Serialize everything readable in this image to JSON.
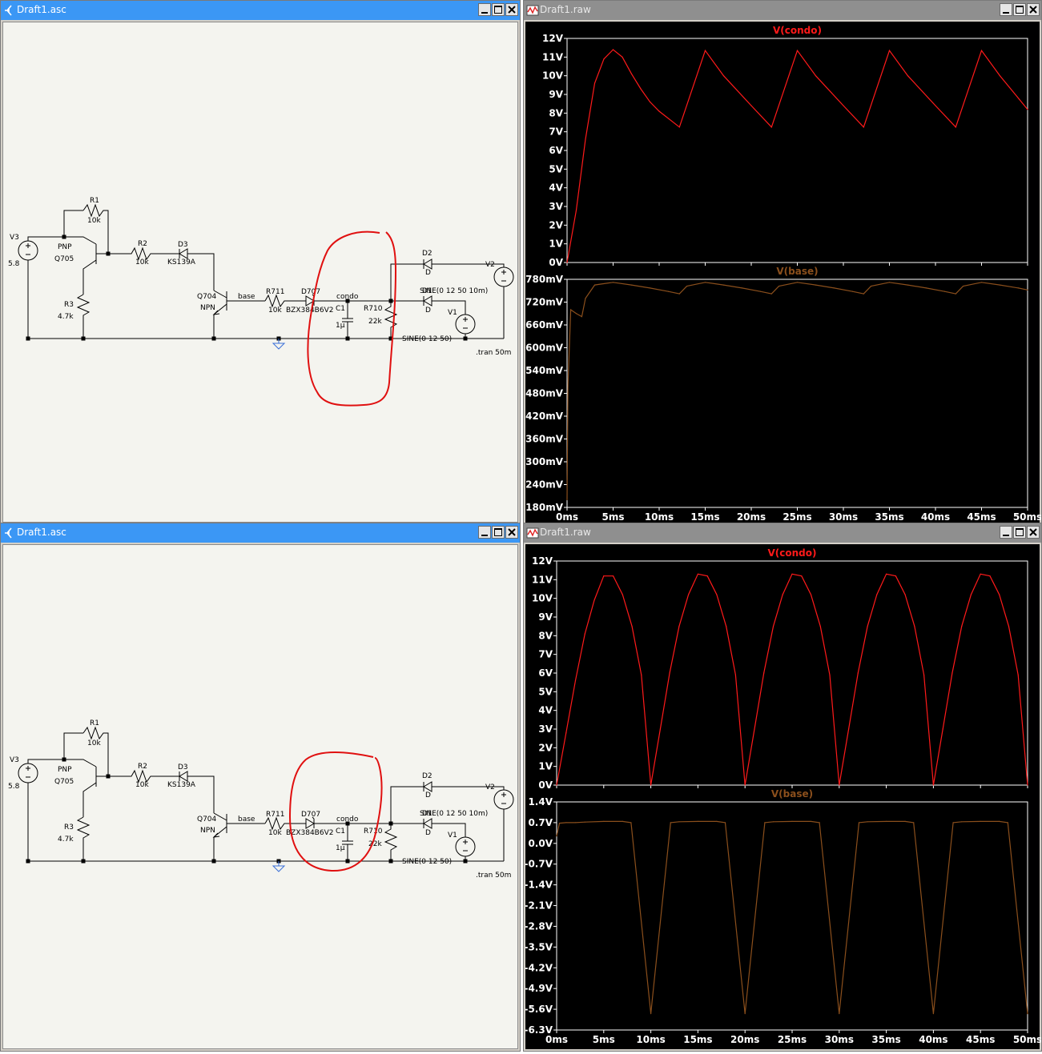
{
  "windows": {
    "schematic_top": {
      "title": "Draft1.asc"
    },
    "waveform_top": {
      "title": "Draft1.raw"
    },
    "schematic_bottom": {
      "title": "Draft1.asc"
    },
    "waveform_bottom": {
      "title": "Draft1.raw"
    }
  },
  "schematic": {
    "labels": {
      "v3": "V3",
      "v3_val": "5.8",
      "r1": "R1",
      "r1_val": "10k",
      "q705_type": "PNP",
      "q705": "Q705",
      "r2": "R2",
      "r2_val": "10k",
      "d3": "D3",
      "d3_val": "KS139A",
      "r3": "R3",
      "r3_val": "4.7k",
      "q704": "Q704",
      "q704_type": "NPN",
      "net_base": "base",
      "r711": "R711",
      "r711_val": "10k",
      "d707": "D707",
      "d707_val": "BZX384B6V2",
      "net_condo": "condo",
      "c1": "C1",
      "c1_val": "1µ",
      "r710": "R710",
      "r710_val": "22k",
      "d2": "D2",
      "d2_val": "D",
      "d1": "D1",
      "d1_val": "D",
      "v2": "V2",
      "v2_val": "SINE(0 12 50 10m)",
      "v1": "V1",
      "v1_val": "SINE(0 12 50)",
      "tran": ".tran 50m"
    }
  },
  "colors": {
    "condo": "#ff1a1a",
    "base": "#8b4f1c",
    "annotation": "#e01010",
    "accent": "#3b97f5"
  },
  "chart_data": [
    {
      "type": "line",
      "title": "V(condo)",
      "series": [
        {
          "name": "V(condo)",
          "x": [
            0,
            1,
            2,
            3,
            4,
            5,
            6,
            7,
            8,
            9,
            10,
            12.2,
            15,
            17,
            20,
            22.2,
            25,
            27,
            30,
            32.2,
            35,
            37,
            40,
            42.2,
            45,
            47,
            50
          ],
          "values": [
            0,
            2.8,
            6.6,
            9.6,
            10.9,
            11.4,
            11,
            10.1,
            9.3,
            8.6,
            8.1,
            7.25,
            11.35,
            10,
            8.4,
            7.25,
            11.35,
            10,
            8.4,
            7.25,
            11.35,
            10,
            8.4,
            7.25,
            11.35,
            10,
            8.2
          ]
        }
      ],
      "ylim": [
        0,
        12
      ],
      "yticks": [
        "0V",
        "1V",
        "2V",
        "3V",
        "4V",
        "5V",
        "6V",
        "7V",
        "8V",
        "9V",
        "10V",
        "11V",
        "12V"
      ],
      "xticks": [
        "0ms",
        "5ms",
        "10ms",
        "15ms",
        "20ms",
        "25ms",
        "30ms",
        "35ms",
        "40ms",
        "45ms",
        "50ms"
      ],
      "xlim": [
        0,
        50
      ]
    },
    {
      "type": "line",
      "title": "V(base)",
      "series": [
        {
          "name": "V(base)",
          "x": [
            0,
            0.1,
            0.4,
            1,
            1.6,
            2,
            3,
            5,
            7,
            9,
            11,
            12.2,
            13,
            15,
            17,
            19,
            21,
            22.2,
            23,
            25,
            27,
            29,
            31,
            32.2,
            33,
            35,
            37,
            39,
            41,
            42.2,
            43,
            45,
            47,
            49,
            50
          ],
          "values": [
            0.2,
            0.5,
            0.7,
            0.69,
            0.682,
            0.73,
            0.765,
            0.772,
            0.765,
            0.757,
            0.748,
            0.742,
            0.762,
            0.772,
            0.765,
            0.757,
            0.748,
            0.742,
            0.762,
            0.772,
            0.765,
            0.757,
            0.748,
            0.742,
            0.762,
            0.772,
            0.765,
            0.757,
            0.748,
            0.742,
            0.762,
            0.772,
            0.765,
            0.757,
            0.752
          ]
        }
      ],
      "ylim": [
        0.18,
        0.78
      ],
      "yticks": [
        "180mV",
        "240mV",
        "300mV",
        "360mV",
        "420mV",
        "480mV",
        "540mV",
        "600mV",
        "660mV",
        "720mV",
        "780mV"
      ],
      "xticks": [
        "0ms",
        "5ms",
        "10ms",
        "15ms",
        "20ms",
        "25ms",
        "30ms",
        "35ms",
        "40ms",
        "45ms",
        "50ms"
      ],
      "xlim": [
        0,
        50
      ]
    },
    {
      "type": "line",
      "title": "V(condo)",
      "series": [
        {
          "name": "V(condo)",
          "x": [
            0,
            1,
            2,
            3,
            4,
            5,
            6,
            7,
            8,
            9,
            10,
            11,
            12,
            13,
            14,
            15,
            16,
            17,
            18,
            19,
            20,
            21,
            22,
            23,
            24,
            25,
            26,
            27,
            28,
            29,
            30,
            31,
            32,
            33,
            34,
            35,
            36,
            37,
            38,
            39,
            40,
            41,
            42,
            43,
            44,
            45,
            46,
            47,
            48,
            49,
            50
          ],
          "values": [
            0,
            2.8,
            5.6,
            8.1,
            9.9,
            11.2,
            11.2,
            10.2,
            8.5,
            5.9,
            0,
            3.0,
            6.0,
            8.5,
            10.2,
            11.3,
            11.2,
            10.2,
            8.5,
            5.9,
            0,
            3.0,
            6.0,
            8.5,
            10.2,
            11.3,
            11.2,
            10.2,
            8.5,
            5.9,
            0,
            3.0,
            6.0,
            8.5,
            10.2,
            11.3,
            11.2,
            10.2,
            8.5,
            5.9,
            0,
            3.0,
            6.0,
            8.5,
            10.2,
            11.3,
            11.2,
            10.2,
            8.5,
            5.9,
            0
          ]
        }
      ],
      "ylim": [
        0,
        12
      ],
      "yticks": [
        "0V",
        "1V",
        "2V",
        "3V",
        "4V",
        "5V",
        "6V",
        "7V",
        "8V",
        "9V",
        "10V",
        "11V",
        "12V"
      ],
      "xticks": [
        "0ms",
        "5ms",
        "10ms",
        "15ms",
        "20ms",
        "25ms",
        "30ms",
        "35ms",
        "40ms",
        "45ms",
        "50ms"
      ],
      "xlim": [
        0,
        50
      ]
    },
    {
      "type": "line",
      "title": "V(base)",
      "series": [
        {
          "name": "V(base)",
          "x": [
            0,
            0.3,
            1,
            2,
            3,
            5,
            7,
            7.9,
            10,
            12.1,
            13,
            15,
            17,
            17.9,
            20,
            22.1,
            23,
            25,
            27,
            27.9,
            30,
            32.1,
            33,
            35,
            37,
            37.9,
            40,
            42.1,
            43,
            45,
            47,
            47.9,
            50
          ],
          "values": [
            0.25,
            0.68,
            0.7,
            0.7,
            0.72,
            0.74,
            0.74,
            0.7,
            -5.75,
            0.7,
            0.73,
            0.74,
            0.74,
            0.7,
            -5.75,
            0.7,
            0.73,
            0.74,
            0.74,
            0.7,
            -5.75,
            0.7,
            0.73,
            0.74,
            0.74,
            0.7,
            -5.75,
            0.7,
            0.73,
            0.74,
            0.74,
            0.7,
            -5.75
          ]
        }
      ],
      "ylim": [
        -6.3,
        1.4
      ],
      "yticks": [
        "-6.3V",
        "-5.6V",
        "-4.9V",
        "-4.2V",
        "-3.5V",
        "-2.8V",
        "-2.1V",
        "-1.4V",
        "-0.7V",
        "0.0V",
        "0.7V",
        "1.4V"
      ],
      "xticks": [
        "0ms",
        "5ms",
        "10ms",
        "15ms",
        "20ms",
        "25ms",
        "30ms",
        "35ms",
        "40ms",
        "45ms",
        "50ms"
      ],
      "xlim": [
        0,
        50
      ]
    }
  ]
}
